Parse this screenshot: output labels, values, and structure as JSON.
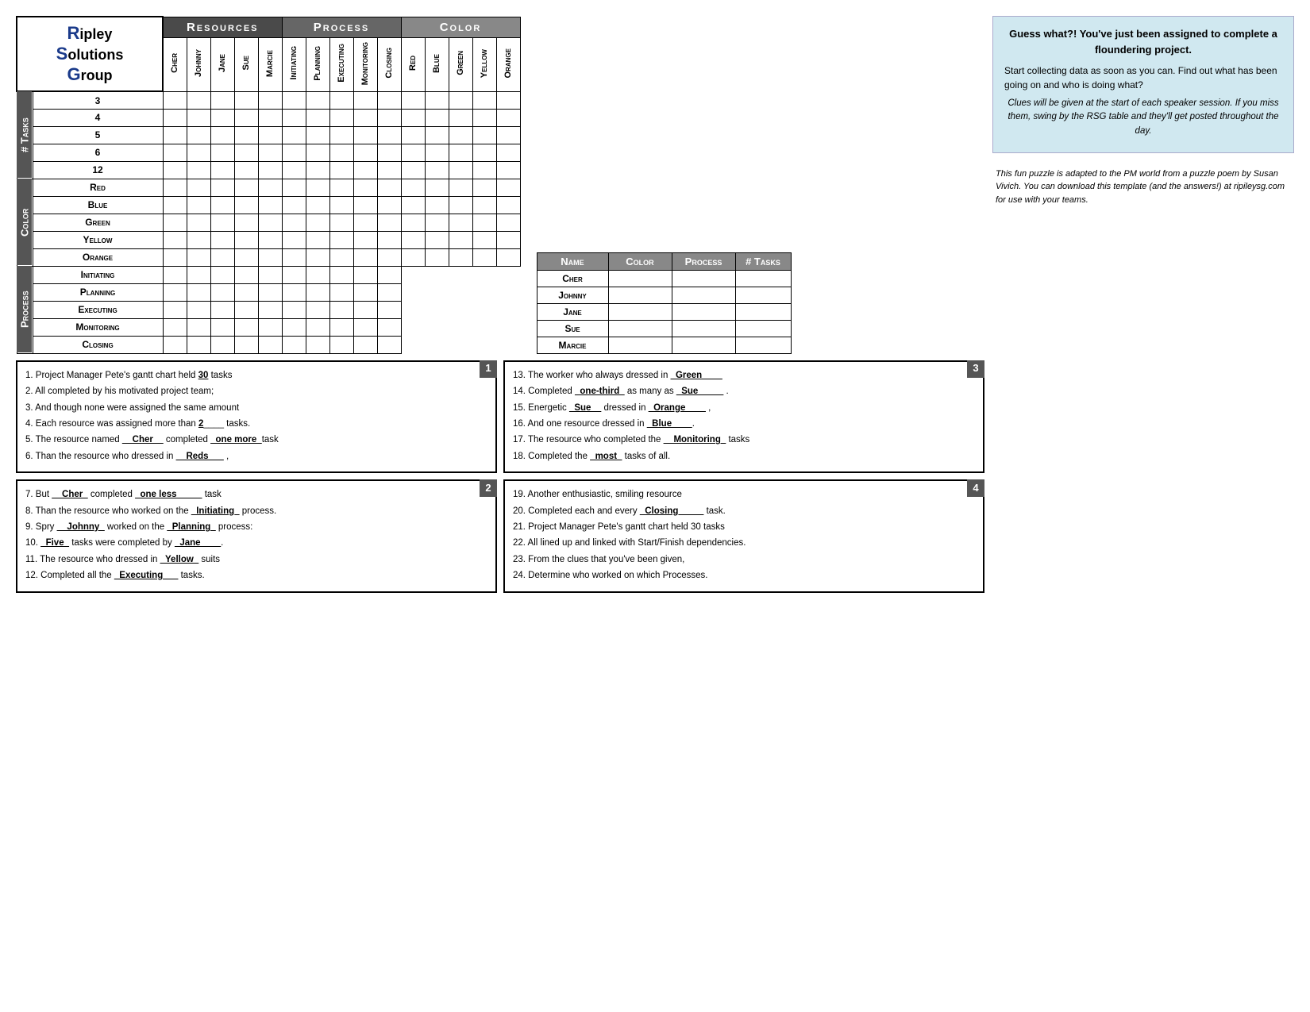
{
  "logo": {
    "line1_r": "R",
    "line1_rest": "ipley",
    "line2_s": "S",
    "line2_rest": "olutions",
    "line3_g": "G",
    "line3_rest": "roup"
  },
  "table": {
    "header_resources": "Resources",
    "header_process": "Process",
    "header_color": "Color",
    "resources_cols": [
      "Cher",
      "Johnny",
      "Jane",
      "Sue",
      "Marcie"
    ],
    "process_cols": [
      "Initiating",
      "Planning",
      "Executing",
      "Monitoring",
      "Closing"
    ],
    "color_cols": [
      "Red",
      "Blue",
      "Green",
      "Yellow",
      "Orange"
    ],
    "tasks_section_label": "# Tasks",
    "tasks_rows": [
      "3",
      "4",
      "5",
      "6",
      "12"
    ],
    "color_section_label": "Color",
    "color_rows": [
      "Red",
      "Blue",
      "Green",
      "Yellow",
      "Orange"
    ],
    "process_section_label": "Process",
    "process_rows": [
      "Initiating",
      "Planning",
      "Executing",
      "Monitoring",
      "Closing"
    ]
  },
  "summary_table": {
    "headers": [
      "Name",
      "Color",
      "Process",
      "# Tasks"
    ],
    "rows": [
      {
        "name": "Cher"
      },
      {
        "name": "Johnny"
      },
      {
        "name": "Jane"
      },
      {
        "name": "Sue"
      },
      {
        "name": "Marcie"
      }
    ]
  },
  "right_panel": {
    "title": "Guess what?! You've just been assigned to complete a floundering project.",
    "para1": "Start collecting data as soon as you can.  Find out what has been going on and who is doing what?",
    "para2_italic": "Clues will be given at the start of each speaker session.  If you miss them, swing by the RSG table and they'll get posted throughout the day.",
    "para3_italic": "This fun puzzle is adapted to the PM world from a puzzle poem by Susan Vivich.  You can download this template (and the answers!) at ripileysg.com for use with your teams."
  },
  "clue_boxes": {
    "box1": {
      "number": "1",
      "clues": [
        "1.  Project Manager Pete's gantt chart held __30__ tasks",
        "2.  All completed by his motivated project team;",
        "3.  And though none were assigned the same amount",
        "4.  Each resource was assigned more than __2____ tasks.",
        "5.  The resource named __Cher__ completed _one more_task",
        "6.  Than the resource who dressed in __Reds___ ,"
      ]
    },
    "box2": {
      "number": "2",
      "clues": [
        "7.  But __Cher_ completed _one less_____ task",
        "8.  Than the resource who worked on the _Initiating_ process.",
        "9.  Spry __Johnny_ worked on the _Planning_ process:",
        "10. _Five_ tasks were completed by _Jane____.",
        "11. The resource who dressed in _Yellow_ suits",
        "12. Completed all the _Executing___ tasks."
      ]
    },
    "box3": {
      "number": "3",
      "clues": [
        "13. The worker who always dressed in _Green____",
        "14. Completed _one-third_ as many as _Sue_____ .",
        "15. Energetic _Sue__ dressed in _Orange____ ,",
        "16. And one resource dressed in _Blue____ .",
        "17. The resource who completed the __Monitoring_ tasks",
        "18. Completed the _most_ tasks of all."
      ]
    },
    "box4": {
      "number": "4",
      "clues": [
        "19. Another enthusiastic, smiling resource",
        "20. Completed each and every _Closing_____ task.",
        "21. Project Manager Pete's gantt chart held 30 tasks",
        "22. All lined up and linked with Start/Finish dependencies.",
        "23. From the clues that you've been given,",
        "24. Determine who worked on which Processes."
      ]
    }
  }
}
